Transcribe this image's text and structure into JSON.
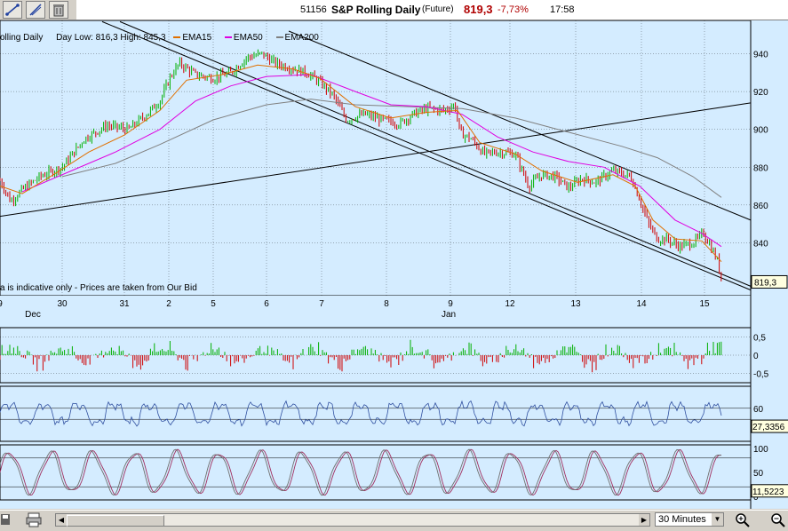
{
  "header": {
    "code": "51156",
    "name": "S&P Rolling Daily",
    "type": "(Future)",
    "price": "819,3",
    "change_pct": "-7,73%",
    "time": "17:58"
  },
  "legend": {
    "title": "olling Daily",
    "range": "Day Low: 816,3 High: 845,3",
    "ema15": "EMA15",
    "ema50": "EMA50",
    "ema200": "EMA200"
  },
  "disclaimer": "a is indicative only - Prices are taken from Our Bid",
  "colors": {
    "bg": "#d4ecff",
    "up": "#00b000",
    "down": "#d00000",
    "ema15": "#e07000",
    "ema50": "#e000e0",
    "ema200": "#808080",
    "osc": "#3050a0",
    "stoch": "#a03060"
  },
  "icons": [
    "crosshair-icon",
    "line-tool-icon",
    "trash-icon",
    "print-icon",
    "zoom-in-icon",
    "zoom-out-icon"
  ],
  "chart_data": [
    {
      "type": "candlestick",
      "title": "S&P Rolling Daily",
      "x_ticks": [
        "9",
        "30",
        "31",
        "2",
        "5",
        "6",
        "7",
        "8",
        "9",
        "12",
        "13",
        "14",
        "15"
      ],
      "x_month_labels": [
        "Dec",
        "Jan"
      ],
      "y_ticks": [
        840,
        860,
        880,
        900,
        920,
        940
      ],
      "ylim": [
        812,
        952
      ],
      "last_value": "819,3",
      "close_path": [
        [
          0,
          873
        ],
        [
          12,
          862
        ],
        [
          25,
          868
        ],
        [
          45,
          875
        ],
        [
          70,
          880
        ],
        [
          95,
          895
        ],
        [
          120,
          902
        ],
        [
          145,
          900
        ],
        [
          165,
          908
        ],
        [
          180,
          915
        ],
        [
          192,
          928
        ],
        [
          202,
          935
        ],
        [
          220,
          929
        ],
        [
          240,
          927
        ],
        [
          260,
          930
        ],
        [
          278,
          938
        ],
        [
          295,
          940
        ],
        [
          310,
          935
        ],
        [
          330,
          932
        ],
        [
          345,
          930
        ],
        [
          360,
          925
        ],
        [
          375,
          918
        ],
        [
          390,
          905
        ],
        [
          410,
          908
        ],
        [
          430,
          905
        ],
        [
          450,
          903
        ],
        [
          465,
          908
        ],
        [
          480,
          911
        ],
        [
          500,
          910
        ],
        [
          512,
          913
        ],
        [
          518,
          898
        ],
        [
          530,
          895
        ],
        [
          545,
          887
        ],
        [
          560,
          888
        ],
        [
          580,
          887
        ],
        [
          595,
          870
        ],
        [
          610,
          876
        ],
        [
          625,
          875
        ],
        [
          640,
          869
        ],
        [
          655,
          874
        ],
        [
          670,
          872
        ],
        [
          690,
          878
        ],
        [
          710,
          875
        ],
        [
          720,
          863
        ],
        [
          730,
          850
        ],
        [
          740,
          842
        ],
        [
          750,
          842
        ],
        [
          765,
          838
        ],
        [
          780,
          840
        ],
        [
          792,
          845
        ],
        [
          800,
          838
        ],
        [
          808,
          830
        ],
        [
          812,
          820
        ]
      ],
      "ema15": [
        [
          0,
          870
        ],
        [
          25,
          866
        ],
        [
          60,
          876
        ],
        [
          100,
          888
        ],
        [
          140,
          897
        ],
        [
          180,
          910
        ],
        [
          210,
          926
        ],
        [
          250,
          929
        ],
        [
          290,
          934
        ],
        [
          330,
          932
        ],
        [
          360,
          927
        ],
        [
          400,
          912
        ],
        [
          440,
          906
        ],
        [
          480,
          909
        ],
        [
          515,
          910
        ],
        [
          540,
          893
        ],
        [
          580,
          887
        ],
        [
          610,
          878
        ],
        [
          650,
          872
        ],
        [
          690,
          876
        ],
        [
          715,
          870
        ],
        [
          735,
          852
        ],
        [
          760,
          842
        ],
        [
          790,
          841
        ],
        [
          812,
          830
        ]
      ],
      "ema50": [
        [
          25,
          867
        ],
        [
          80,
          878
        ],
        [
          130,
          888
        ],
        [
          180,
          900
        ],
        [
          220,
          915
        ],
        [
          260,
          923
        ],
        [
          300,
          928
        ],
        [
          350,
          929
        ],
        [
          400,
          920
        ],
        [
          440,
          913
        ],
        [
          480,
          912
        ],
        [
          520,
          908
        ],
        [
          560,
          896
        ],
        [
          600,
          888
        ],
        [
          640,
          883
        ],
        [
          680,
          880
        ],
        [
          720,
          870
        ],
        [
          760,
          852
        ],
        [
          790,
          845
        ],
        [
          812,
          838
        ]
      ],
      "ema200": [
        [
          70,
          875
        ],
        [
          130,
          882
        ],
        [
          180,
          892
        ],
        [
          240,
          905
        ],
        [
          300,
          913
        ],
        [
          350,
          916
        ],
        [
          400,
          913
        ],
        [
          460,
          912
        ],
        [
          520,
          911
        ],
        [
          580,
          906
        ],
        [
          620,
          901
        ],
        [
          660,
          896
        ],
        [
          700,
          891
        ],
        [
          740,
          885
        ],
        [
          780,
          875
        ],
        [
          812,
          864
        ]
      ],
      "trendlines": [
        {
          "from": [
            0,
            854
          ],
          "to": [
            845,
            914
          ]
        },
        {
          "from": [
            135,
            957
          ],
          "to": [
            845,
            817
          ]
        },
        {
          "from": [
            115,
            957
          ],
          "to": [
            845,
            815
          ]
        },
        {
          "from": [
            325,
            952
          ],
          "to": [
            845,
            852
          ]
        }
      ]
    },
    {
      "type": "bar",
      "title": "",
      "y_ticks": [
        "0,5",
        "0",
        "-0,5"
      ],
      "ylim": [
        -0.75,
        0.75
      ]
    },
    {
      "type": "line",
      "title": "",
      "y_ticks": [
        "60"
      ],
      "last_value": "27,3356"
    },
    {
      "type": "line",
      "title": "",
      "y_ticks": [
        "100",
        "50",
        "0"
      ],
      "last_value": "11,5223"
    }
  ],
  "bottom": {
    "interval": "30 Minutes"
  }
}
